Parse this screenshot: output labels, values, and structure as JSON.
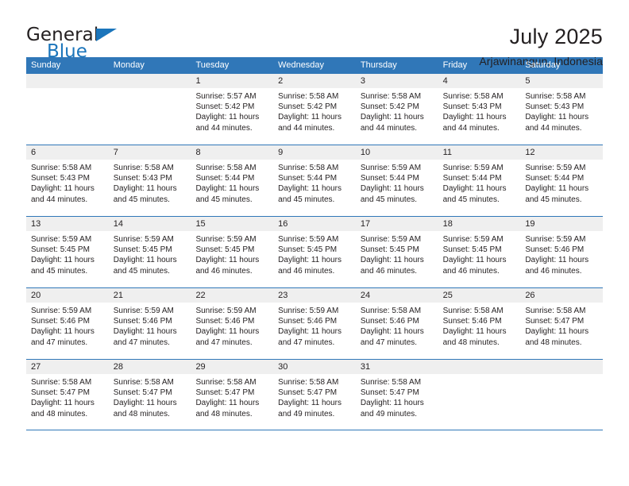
{
  "brand": {
    "word_one": "General",
    "word_two": "Blue",
    "accent_color": "#1b75bb",
    "triangle_icon": "brand-triangle-icon"
  },
  "header": {
    "title": "July 2025",
    "subtitle": "Arjawinangun, Indonesia"
  },
  "colors": {
    "header_blue": "#3077b8",
    "daynum_band": "#efefef",
    "text": "#231f20"
  },
  "calendar": {
    "day_headers": [
      "Sunday",
      "Monday",
      "Tuesday",
      "Wednesday",
      "Thursday",
      "Friday",
      "Saturday"
    ],
    "weeks": [
      [
        {
          "day": "",
          "sunrise": "",
          "sunset": "",
          "daylight_line1": "",
          "daylight_line2": ""
        },
        {
          "day": "",
          "sunrise": "",
          "sunset": "",
          "daylight_line1": "",
          "daylight_line2": ""
        },
        {
          "day": "1",
          "sunrise": "Sunrise: 5:57 AM",
          "sunset": "Sunset: 5:42 PM",
          "daylight_line1": "Daylight: 11 hours",
          "daylight_line2": "and 44 minutes."
        },
        {
          "day": "2",
          "sunrise": "Sunrise: 5:58 AM",
          "sunset": "Sunset: 5:42 PM",
          "daylight_line1": "Daylight: 11 hours",
          "daylight_line2": "and 44 minutes."
        },
        {
          "day": "3",
          "sunrise": "Sunrise: 5:58 AM",
          "sunset": "Sunset: 5:42 PM",
          "daylight_line1": "Daylight: 11 hours",
          "daylight_line2": "and 44 minutes."
        },
        {
          "day": "4",
          "sunrise": "Sunrise: 5:58 AM",
          "sunset": "Sunset: 5:43 PM",
          "daylight_line1": "Daylight: 11 hours",
          "daylight_line2": "and 44 minutes."
        },
        {
          "day": "5",
          "sunrise": "Sunrise: 5:58 AM",
          "sunset": "Sunset: 5:43 PM",
          "daylight_line1": "Daylight: 11 hours",
          "daylight_line2": "and 44 minutes."
        }
      ],
      [
        {
          "day": "6",
          "sunrise": "Sunrise: 5:58 AM",
          "sunset": "Sunset: 5:43 PM",
          "daylight_line1": "Daylight: 11 hours",
          "daylight_line2": "and 44 minutes."
        },
        {
          "day": "7",
          "sunrise": "Sunrise: 5:58 AM",
          "sunset": "Sunset: 5:43 PM",
          "daylight_line1": "Daylight: 11 hours",
          "daylight_line2": "and 45 minutes."
        },
        {
          "day": "8",
          "sunrise": "Sunrise: 5:58 AM",
          "sunset": "Sunset: 5:44 PM",
          "daylight_line1": "Daylight: 11 hours",
          "daylight_line2": "and 45 minutes."
        },
        {
          "day": "9",
          "sunrise": "Sunrise: 5:58 AM",
          "sunset": "Sunset: 5:44 PM",
          "daylight_line1": "Daylight: 11 hours",
          "daylight_line2": "and 45 minutes."
        },
        {
          "day": "10",
          "sunrise": "Sunrise: 5:59 AM",
          "sunset": "Sunset: 5:44 PM",
          "daylight_line1": "Daylight: 11 hours",
          "daylight_line2": "and 45 minutes."
        },
        {
          "day": "11",
          "sunrise": "Sunrise: 5:59 AM",
          "sunset": "Sunset: 5:44 PM",
          "daylight_line1": "Daylight: 11 hours",
          "daylight_line2": "and 45 minutes."
        },
        {
          "day": "12",
          "sunrise": "Sunrise: 5:59 AM",
          "sunset": "Sunset: 5:44 PM",
          "daylight_line1": "Daylight: 11 hours",
          "daylight_line2": "and 45 minutes."
        }
      ],
      [
        {
          "day": "13",
          "sunrise": "Sunrise: 5:59 AM",
          "sunset": "Sunset: 5:45 PM",
          "daylight_line1": "Daylight: 11 hours",
          "daylight_line2": "and 45 minutes."
        },
        {
          "day": "14",
          "sunrise": "Sunrise: 5:59 AM",
          "sunset": "Sunset: 5:45 PM",
          "daylight_line1": "Daylight: 11 hours",
          "daylight_line2": "and 45 minutes."
        },
        {
          "day": "15",
          "sunrise": "Sunrise: 5:59 AM",
          "sunset": "Sunset: 5:45 PM",
          "daylight_line1": "Daylight: 11 hours",
          "daylight_line2": "and 46 minutes."
        },
        {
          "day": "16",
          "sunrise": "Sunrise: 5:59 AM",
          "sunset": "Sunset: 5:45 PM",
          "daylight_line1": "Daylight: 11 hours",
          "daylight_line2": "and 46 minutes."
        },
        {
          "day": "17",
          "sunrise": "Sunrise: 5:59 AM",
          "sunset": "Sunset: 5:45 PM",
          "daylight_line1": "Daylight: 11 hours",
          "daylight_line2": "and 46 minutes."
        },
        {
          "day": "18",
          "sunrise": "Sunrise: 5:59 AM",
          "sunset": "Sunset: 5:45 PM",
          "daylight_line1": "Daylight: 11 hours",
          "daylight_line2": "and 46 minutes."
        },
        {
          "day": "19",
          "sunrise": "Sunrise: 5:59 AM",
          "sunset": "Sunset: 5:46 PM",
          "daylight_line1": "Daylight: 11 hours",
          "daylight_line2": "and 46 minutes."
        }
      ],
      [
        {
          "day": "20",
          "sunrise": "Sunrise: 5:59 AM",
          "sunset": "Sunset: 5:46 PM",
          "daylight_line1": "Daylight: 11 hours",
          "daylight_line2": "and 47 minutes."
        },
        {
          "day": "21",
          "sunrise": "Sunrise: 5:59 AM",
          "sunset": "Sunset: 5:46 PM",
          "daylight_line1": "Daylight: 11 hours",
          "daylight_line2": "and 47 minutes."
        },
        {
          "day": "22",
          "sunrise": "Sunrise: 5:59 AM",
          "sunset": "Sunset: 5:46 PM",
          "daylight_line1": "Daylight: 11 hours",
          "daylight_line2": "and 47 minutes."
        },
        {
          "day": "23",
          "sunrise": "Sunrise: 5:59 AM",
          "sunset": "Sunset: 5:46 PM",
          "daylight_line1": "Daylight: 11 hours",
          "daylight_line2": "and 47 minutes."
        },
        {
          "day": "24",
          "sunrise": "Sunrise: 5:58 AM",
          "sunset": "Sunset: 5:46 PM",
          "daylight_line1": "Daylight: 11 hours",
          "daylight_line2": "and 47 minutes."
        },
        {
          "day": "25",
          "sunrise": "Sunrise: 5:58 AM",
          "sunset": "Sunset: 5:46 PM",
          "daylight_line1": "Daylight: 11 hours",
          "daylight_line2": "and 48 minutes."
        },
        {
          "day": "26",
          "sunrise": "Sunrise: 5:58 AM",
          "sunset": "Sunset: 5:47 PM",
          "daylight_line1": "Daylight: 11 hours",
          "daylight_line2": "and 48 minutes."
        }
      ],
      [
        {
          "day": "27",
          "sunrise": "Sunrise: 5:58 AM",
          "sunset": "Sunset: 5:47 PM",
          "daylight_line1": "Daylight: 11 hours",
          "daylight_line2": "and 48 minutes."
        },
        {
          "day": "28",
          "sunrise": "Sunrise: 5:58 AM",
          "sunset": "Sunset: 5:47 PM",
          "daylight_line1": "Daylight: 11 hours",
          "daylight_line2": "and 48 minutes."
        },
        {
          "day": "29",
          "sunrise": "Sunrise: 5:58 AM",
          "sunset": "Sunset: 5:47 PM",
          "daylight_line1": "Daylight: 11 hours",
          "daylight_line2": "and 48 minutes."
        },
        {
          "day": "30",
          "sunrise": "Sunrise: 5:58 AM",
          "sunset": "Sunset: 5:47 PM",
          "daylight_line1": "Daylight: 11 hours",
          "daylight_line2": "and 49 minutes."
        },
        {
          "day": "31",
          "sunrise": "Sunrise: 5:58 AM",
          "sunset": "Sunset: 5:47 PM",
          "daylight_line1": "Daylight: 11 hours",
          "daylight_line2": "and 49 minutes."
        },
        {
          "day": "",
          "sunrise": "",
          "sunset": "",
          "daylight_line1": "",
          "daylight_line2": ""
        },
        {
          "day": "",
          "sunrise": "",
          "sunset": "",
          "daylight_line1": "",
          "daylight_line2": ""
        }
      ]
    ]
  }
}
